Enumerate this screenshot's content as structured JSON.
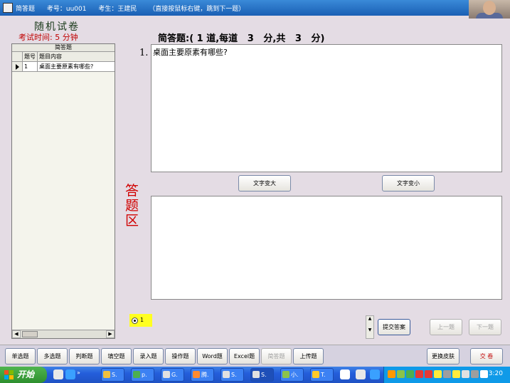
{
  "titlebar": {
    "section": "简答题",
    "exam_no": "考号：uu001",
    "examinee": "考生：王建民",
    "hint": "（直接按鼠标右键，跳到下一题）"
  },
  "paper": {
    "title": "随机试卷",
    "exam_time": "考试时间:  5  分钟"
  },
  "question_list": {
    "caption": "简答题",
    "columns": [
      "题号",
      "题目内容"
    ],
    "rows": [
      {
        "num": "1",
        "content": "桌面主要原素有哪些?"
      }
    ],
    "scroll_left": "◀",
    "scroll_right": "▶"
  },
  "section_heading": "简答题:( 1 道,每道   3   分,共   3   分)",
  "question": {
    "number": "1.",
    "text": "桌面主要原素有哪些?"
  },
  "buttons": {
    "font_bigger": "文字变大",
    "font_smaller": "文字变小",
    "submit": "提交答案",
    "prev": "上一题",
    "next": "下一题"
  },
  "answer_area_label": "答题区",
  "radio": {
    "label": "1"
  },
  "question_types": {
    "single_choice": "单选题",
    "multi_choice": "多选题",
    "true_false": "判断题",
    "fill_blank": "填空题",
    "typing": "录入题",
    "operation": "操作题",
    "word": "Word题",
    "excel": "Excel题",
    "short_answer": "简答题",
    "upload": "上传题",
    "change_skin": "更换皮肤",
    "hand_in": "交 卷"
  },
  "taskbar": {
    "start_label": "开始",
    "tasks": [
      "S.",
      "p.",
      "G.",
      "腾.",
      "S.",
      "S.",
      "小.",
      "T."
    ],
    "clock": "3:20"
  },
  "colors": {
    "background": "#e4dce4",
    "accent_red": "#d00000",
    "highlight_yellow": "#ffff20"
  }
}
